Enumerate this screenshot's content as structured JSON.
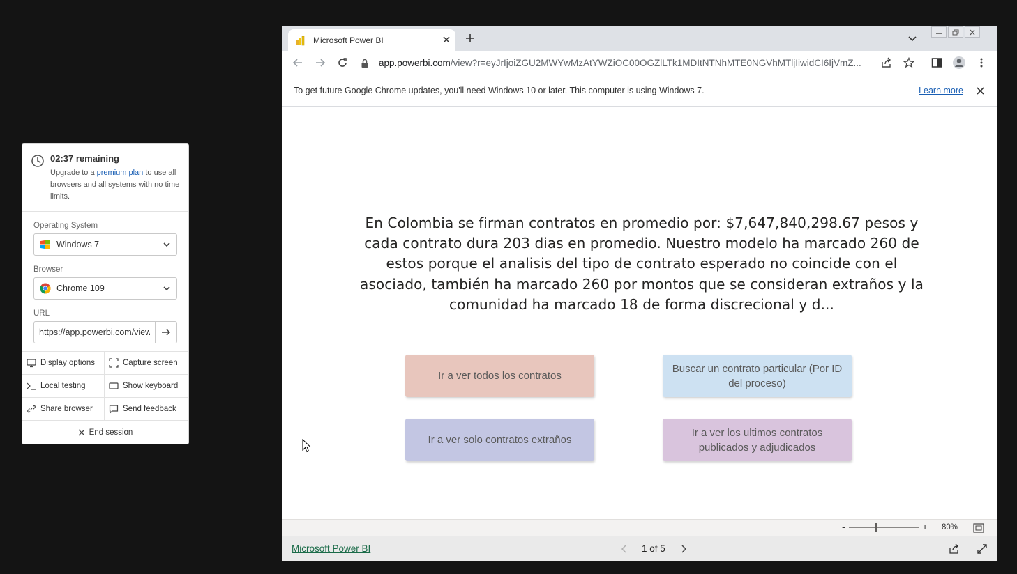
{
  "session_panel": {
    "timer_title": "02:37 remaining",
    "upgrade_prefix": "Upgrade to a ",
    "upgrade_link": "premium plan",
    "upgrade_suffix": " to use all browsers and all systems with no time limits.",
    "os_label": "Operating System",
    "os_value": "Windows 7",
    "browser_label": "Browser",
    "browser_value": "Chrome 109",
    "url_label": "URL",
    "url_value": "https://app.powerbi.com/view",
    "actions": {
      "display_options": "Display options",
      "capture_screen": "Capture screen",
      "local_testing": "Local testing",
      "show_keyboard": "Show keyboard",
      "share_browser": "Share browser",
      "send_feedback": "Send feedback"
    },
    "end_session": "End session"
  },
  "browser": {
    "tab_title": "Microsoft Power BI",
    "address_host": "app.powerbi.com",
    "address_path": "/view?r=eyJrIjoiZGU2MWYwMzAtYWZiOC00OGZlLTk1MDItNTNhMTE0NGVhMTljIiwidCI6IjVmZ...",
    "infobar_text": "To get future Google Chrome updates, you'll need Windows 10 or later. This computer is using Windows 7.",
    "infobar_link": "Learn more"
  },
  "report": {
    "message": "En Colombia se firman contratos en promedio por: $7,647,840,298.67 pesos y cada contrato dura 203 dias en promedio. Nuestro modelo ha marcado 260 de estos porque el analisis del tipo de contrato esperado no coincide con el asociado, también ha marcado 260 por montos que se consideran extraños y la comunidad ha marcado 18 de forma discrecional y d...",
    "buttons": {
      "all_contracts": "Ir a ver todos los contratos",
      "search_contract": "Buscar un contrato particular (Por ID del proceso)",
      "strange_contracts": "Ir a ver solo contratos extraños",
      "latest_contracts": "Ir a ver los ultimos contratos publicados y adjudicados"
    },
    "zoom_minus": "-",
    "zoom_plus": "+",
    "zoom_level": "80%",
    "footer_brand": "Microsoft Power BI",
    "page_indicator": "1 of 5"
  },
  "colors": {
    "btn_all": "#e8c6bd",
    "btn_search": "#cde1f2",
    "btn_strange": "#c3c6e3",
    "btn_latest": "#d9c4dd"
  }
}
